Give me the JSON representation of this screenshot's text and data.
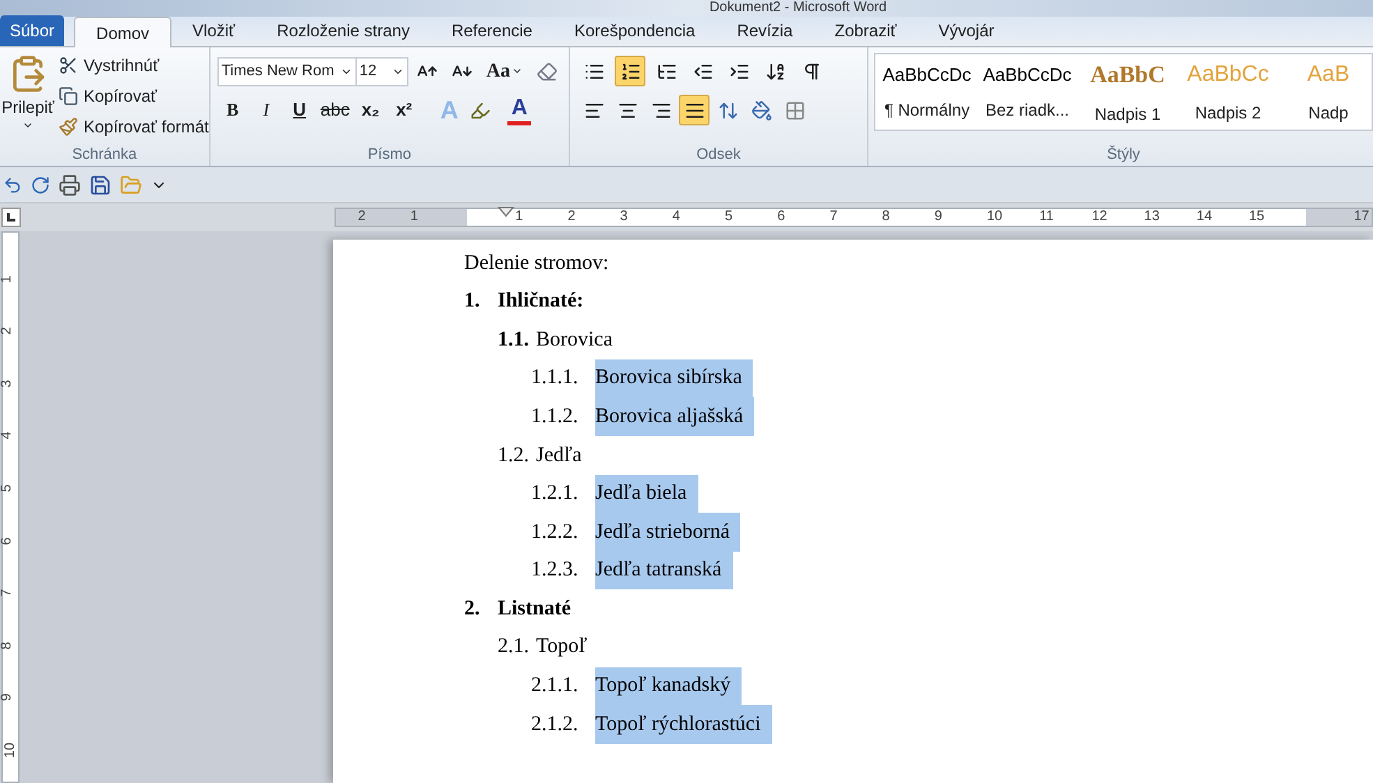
{
  "window": {
    "title": "Dokument2 - Microsoft Word"
  },
  "tabs": [
    {
      "label": "Súbor",
      "kind": "file",
      "selected": false
    },
    {
      "label": "Domov",
      "kind": "tab",
      "selected": true
    },
    {
      "label": "Vložiť",
      "kind": "tab",
      "selected": false
    },
    {
      "label": "Rozloženie strany",
      "kind": "tab",
      "selected": false
    },
    {
      "label": "Referencie",
      "kind": "tab",
      "selected": false
    },
    {
      "label": "Korešpondencia",
      "kind": "tab",
      "selected": false
    },
    {
      "label": "Revízia",
      "kind": "tab",
      "selected": false
    },
    {
      "label": "Zobraziť",
      "kind": "tab",
      "selected": false
    },
    {
      "label": "Vývojár",
      "kind": "tab",
      "selected": false
    }
  ],
  "clipboard": {
    "label": "Schránka",
    "paste": "Prilepiť",
    "cut": "Vystrihnúť",
    "copy": "Kopírovať",
    "format_painter": "Kopírovať formát"
  },
  "font": {
    "label": "Písmo",
    "font_name": "Times New Rom",
    "font_size": "12",
    "change_case": "Aa",
    "format_buttons": [
      {
        "glyph": "B",
        "kind": "bold"
      },
      {
        "glyph": "I",
        "kind": "italic"
      },
      {
        "glyph": "U",
        "kind": "underline"
      },
      {
        "glyph": "abc",
        "kind": "strike"
      },
      {
        "glyph": "x₂",
        "kind": "plain"
      },
      {
        "glyph": "x²",
        "kind": "plain"
      }
    ],
    "text_effects": "A",
    "font_color": "A"
  },
  "paragraph": {
    "label": "Odsek",
    "bullets_selected": false,
    "numbering_selected": true,
    "alignment": [
      {
        "kind": "left",
        "selected": false
      },
      {
        "kind": "center",
        "selected": false
      },
      {
        "kind": "right",
        "selected": false
      },
      {
        "kind": "justify",
        "selected": true
      }
    ]
  },
  "styles": {
    "label": "Štýly",
    "items": [
      {
        "preview": "AaBbCcDc",
        "name": "¶ Normálny",
        "kind": "normal"
      },
      {
        "preview": "AaBbCcDc",
        "name": "Bez riadk...",
        "kind": "normal"
      },
      {
        "preview": "AaBbC",
        "name": "Nadpis 1",
        "kind": "heading1"
      },
      {
        "preview": "AaBbCc",
        "name": "Nadpis 2",
        "kind": "heading2"
      },
      {
        "preview": "AaB",
        "name": "Nadp",
        "kind": "heading2"
      }
    ]
  },
  "horizontal_ruler": {
    "left_labels": [
      "2",
      "1"
    ],
    "labels": [
      "1",
      "2",
      "3",
      "4",
      "5",
      "6",
      "7",
      "8",
      "9",
      "10",
      "11",
      "12",
      "13",
      "14",
      "15",
      "17"
    ]
  },
  "vertical_ruler": {
    "labels": [
      "1",
      "2",
      "3",
      "4",
      "5",
      "6",
      "7",
      "8",
      "9",
      "10"
    ]
  },
  "document": {
    "heading": "Delenie stromov:",
    "list": [
      {
        "number": "1.",
        "text": "Ihličnaté:",
        "number_bold": true,
        "text_bold": true,
        "children": [
          {
            "number": "1.1.",
            "text": "Borovica",
            "number_bold": true,
            "text_bold": false,
            "children": [
              {
                "number": "1.1.1.",
                "text": "Borovica sibírska",
                "selected": true
              },
              {
                "number": "1.1.2.",
                "text": "Borovica aljašská",
                "selected": true
              }
            ]
          },
          {
            "number": "1.2.",
            "text": "Jedľa",
            "number_bold": false,
            "text_bold": false,
            "children": [
              {
                "number": "1.2.1.",
                "text": "Jedľa biela",
                "selected": true
              },
              {
                "number": "1.2.2.",
                "text": "Jedľa strieborná",
                "selected": true
              },
              {
                "number": "1.2.3.",
                "text": "Jedľa tatranská",
                "selected": true
              }
            ]
          }
        ]
      },
      {
        "number": "2.",
        "text": "Listnaté",
        "number_bold": true,
        "text_bold": true,
        "children": [
          {
            "number": "2.1.",
            "text": "Topoľ",
            "number_bold": false,
            "text_bold": false,
            "children": [
              {
                "number": "2.1.1.",
                "text": "Topoľ kanadský",
                "selected": true
              },
              {
                "number": "2.1.2.",
                "text": "Topoľ rýchlorastúci",
                "selected": true
              }
            ]
          }
        ]
      }
    ]
  }
}
